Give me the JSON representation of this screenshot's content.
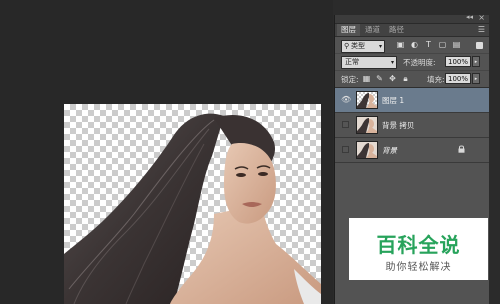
{
  "panel": {
    "tabs": [
      {
        "label": "图层",
        "active": true
      },
      {
        "label": "通道",
        "active": false
      },
      {
        "label": "路径",
        "active": false
      }
    ],
    "collapse_icon": "double-chevron-icon",
    "menu_icon": "panel-menu-icon"
  },
  "filter": {
    "kind_label": "类型",
    "buttons": [
      "image-filter-icon",
      "adjustment-filter-icon",
      "type-filter-icon",
      "shape-filter-icon",
      "smart-object-filter-icon"
    ]
  },
  "blend": {
    "mode": "正常",
    "opacity_label": "不透明度:",
    "opacity": "100%"
  },
  "lock": {
    "label": "锁定:",
    "buttons": [
      "lock-transparent-icon",
      "lock-image-icon",
      "lock-position-icon",
      "lock-all-icon"
    ],
    "fill_label": "填充:",
    "fill": "100%"
  },
  "layers": [
    {
      "name": "图层 1",
      "visible": true,
      "selected": true,
      "italic": false,
      "locked": false
    },
    {
      "name": "背景 拷贝",
      "visible": false,
      "selected": false,
      "italic": false,
      "locked": false
    },
    {
      "name": "背景",
      "visible": false,
      "selected": false,
      "italic": true,
      "locked": true
    }
  ],
  "watermark": {
    "title": "百科全说",
    "subtitle": "助你轻松解决",
    "color": "#27a35b"
  },
  "colors": {
    "panel_bg": "#535353",
    "selected_layer": "#6a7b8d",
    "workspace": "#282828"
  }
}
